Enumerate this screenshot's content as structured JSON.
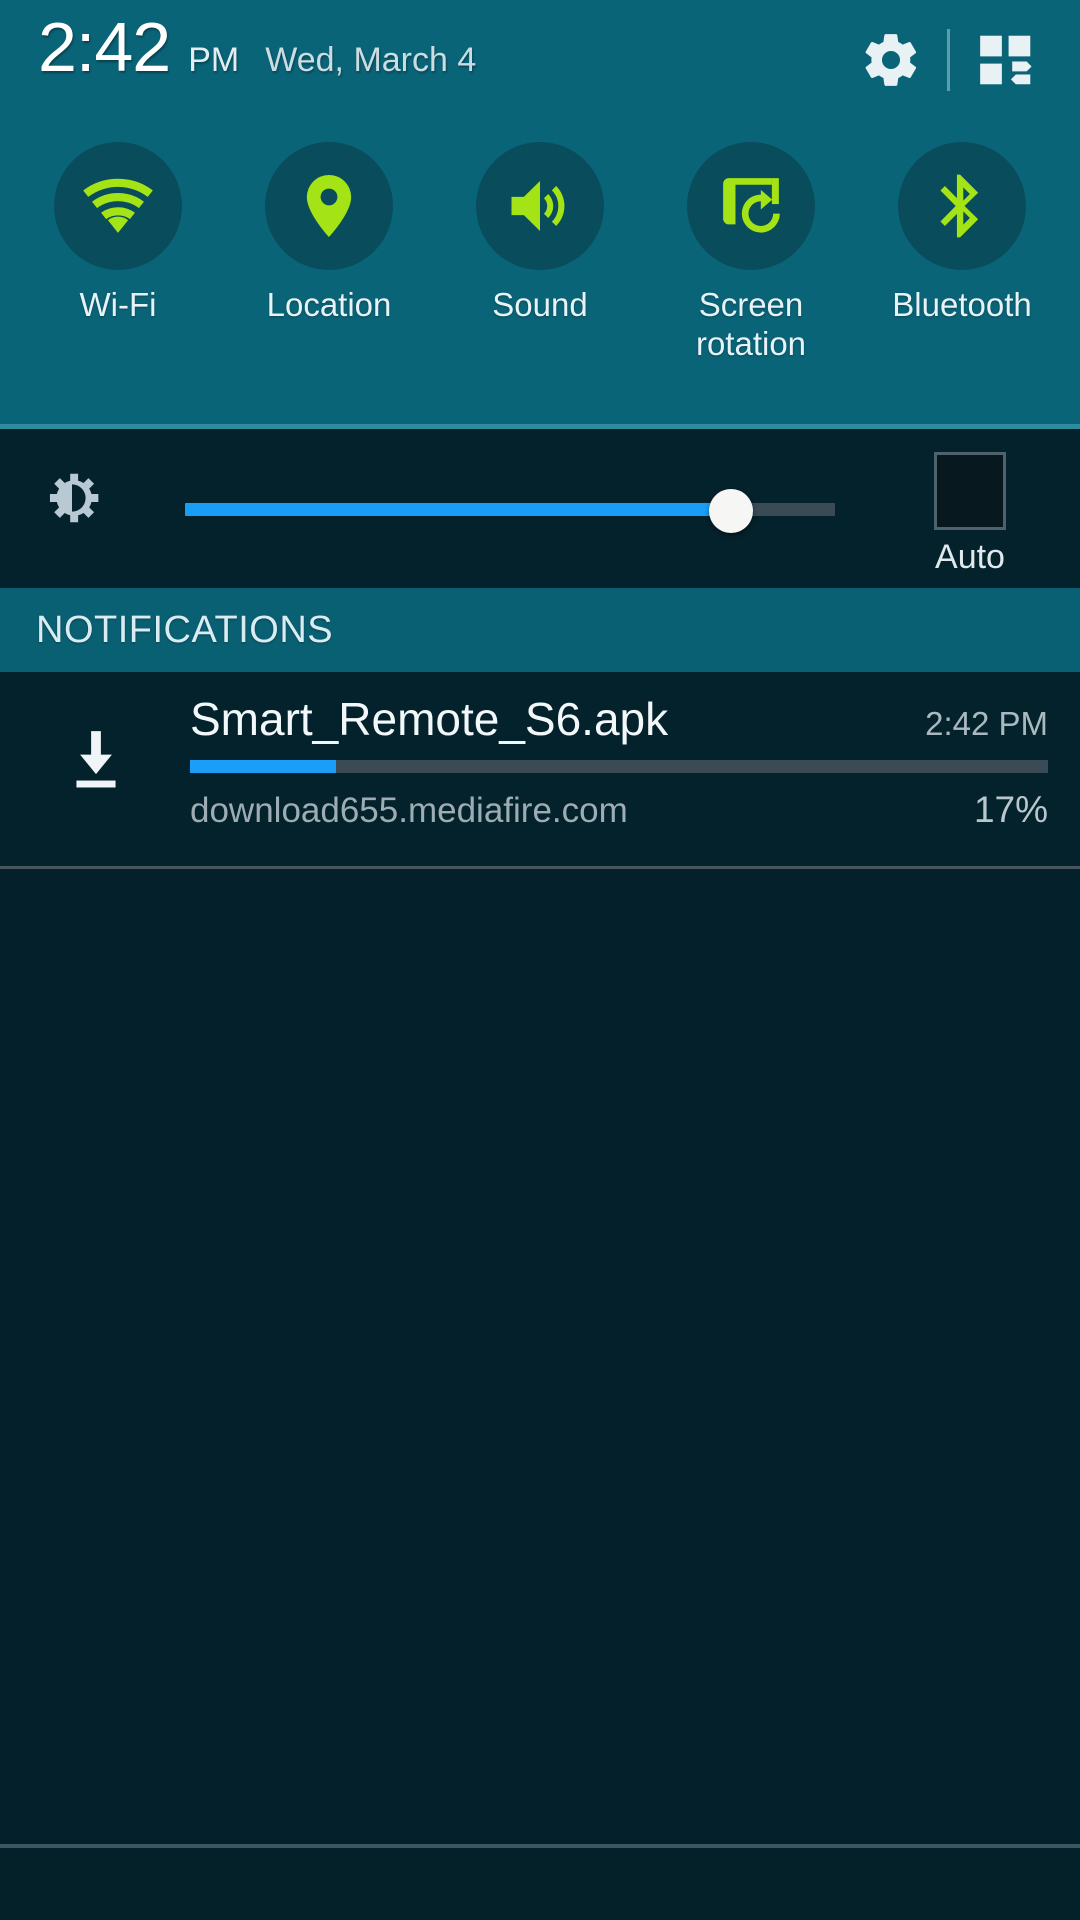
{
  "status_bar": {
    "time": "2:42",
    "ampm": "PM",
    "date": "Wed, March 4",
    "settings_icon": "gear-icon",
    "quick_settings_icon": "quick-settings-grid-icon"
  },
  "quick_toggles": [
    {
      "label": "Wi-Fi",
      "icon": "wifi-icon",
      "state": "on"
    },
    {
      "label": "Location",
      "icon": "location-pin-icon",
      "state": "on"
    },
    {
      "label": "Sound",
      "icon": "sound-speaker-icon",
      "state": "on"
    },
    {
      "label": "Screen\nrotation",
      "icon": "screen-rotation-icon",
      "state": "on"
    },
    {
      "label": "Bluetooth",
      "icon": "bluetooth-icon",
      "state": "on"
    }
  ],
  "brightness": {
    "icon": "brightness-gear-icon",
    "value_percent": 84,
    "auto_label": "Auto",
    "auto_checked": false
  },
  "notifications_section": {
    "title": "NOTIFICATIONS",
    "items": [
      {
        "icon": "download-icon",
        "title": "Smart_Remote_S6.apk",
        "time": "2:42 PM",
        "subtitle": "download655.mediafire.com",
        "progress_percent": 17,
        "progress_label": "17%"
      }
    ]
  },
  "colors": {
    "panel_teal": "#0a6478",
    "toggle_circle": "#094c5c",
    "toggle_icon_green": "#a4e315",
    "shade_dark": "#04202a",
    "accent_blue": "#1a9ef7",
    "section_header_teal": "#0a6073"
  }
}
